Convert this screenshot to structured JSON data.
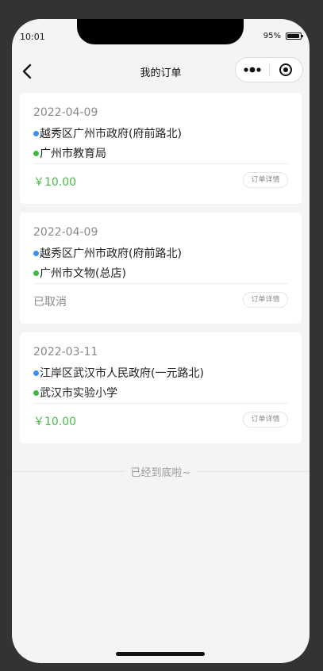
{
  "status_bar": {
    "time": "10:01",
    "battery_percent": "95%",
    "battery_level": 0.95
  },
  "navbar": {
    "title": "我的订单",
    "back_icon": "chevron-left-icon",
    "more_icon": "more-dots-icon",
    "close_icon": "target-circle-icon"
  },
  "orders": [
    {
      "date": "2022-04-09",
      "from": "越秀区广州市政府(府前路北)",
      "to": "广州市教育局",
      "status": "￥10.00",
      "status_type": "price",
      "detail_label": "订单详情"
    },
    {
      "date": "2022-04-09",
      "from": "越秀区广州市政府(府前路北)",
      "to": "广州市文物(总店)",
      "status": "已取消",
      "status_type": "cancelled",
      "detail_label": "订单详情"
    },
    {
      "date": "2022-03-11",
      "from": "江岸区武汉市人民政府(一元路北)",
      "to": "武汉市实验小学",
      "status": "￥10.00",
      "status_type": "price",
      "detail_label": "订单详情"
    }
  ],
  "footer": {
    "end_text": "已经到底啦~"
  },
  "colors": {
    "price": "#4cb84a",
    "origin_dot": "#3b8ff5",
    "destination_dot": "#3fb83f",
    "background": "#f4f4f2"
  }
}
